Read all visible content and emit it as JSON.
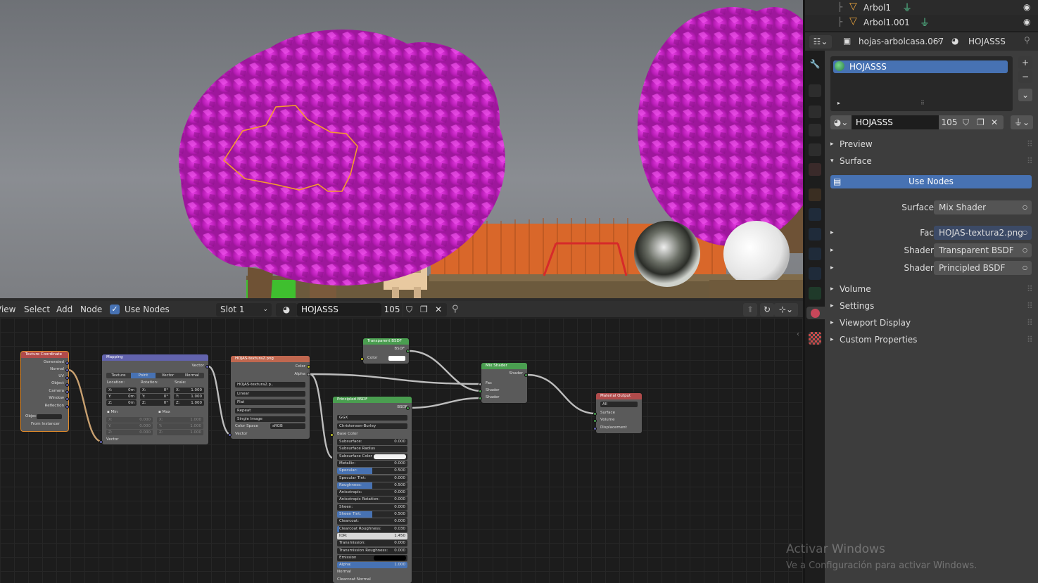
{
  "node_header": {
    "menu": [
      "View",
      "Select",
      "Add",
      "Node"
    ],
    "use_nodes_label": "Use Nodes",
    "slot": "Slot 1",
    "material_name": "HOJASSS",
    "users": "105"
  },
  "nodes": {
    "texcoord": {
      "title": "Texture Coordinate",
      "outputs": [
        "Generated",
        "Normal",
        "UV",
        "Object",
        "Camera",
        "Window",
        "Reflection"
      ],
      "object_label": "Objec",
      "from_instancer": "From Instancer"
    },
    "mapping": {
      "title": "Mapping",
      "output": "Vector",
      "types": [
        "Texture",
        "Point",
        "Vector",
        "Normal"
      ],
      "col_labels": [
        "Location:",
        "Rotation:",
        "Scale:"
      ],
      "loc": [
        "0m",
        "0m",
        "0m"
      ],
      "rot": [
        "0°",
        "0°",
        "0°"
      ],
      "scale": [
        "1.000",
        "1.000",
        "1.000"
      ],
      "min_label": "Min",
      "max_label": "Max",
      "min": [
        "0.000",
        "0.000",
        "0.000"
      ],
      "max": [
        "1.000",
        "1.000",
        "1.000"
      ],
      "input": "Vector"
    },
    "image": {
      "title": "HOJAS-textura2.png",
      "outputs": [
        "Color",
        "Alpha"
      ],
      "image_name": "HOJAS-textura2.p..",
      "interp": "Linear",
      "proj": "Flat",
      "ext": "Repeat",
      "source": "Single Image",
      "cs_label": "Color Space",
      "cs": "sRGB",
      "input": "Vector"
    },
    "transparent": {
      "title": "Transparent BSDF",
      "output": "BSDF",
      "color": "Color"
    },
    "principled": {
      "title": "Principled BSDF",
      "output": "BSDF",
      "dist": "GGX",
      "sss": "Christensen-Burley",
      "base": "Base Color",
      "props": [
        {
          "l": "Subsurface:",
          "v": "0.000",
          "f": 0
        },
        {
          "l": "Subsurface Radius",
          "v": "",
          "f": 0
        },
        {
          "l": "Subsurface Color",
          "v": "",
          "f": 0,
          "white": true
        },
        {
          "l": "Metallic:",
          "v": "0.000",
          "f": 0
        },
        {
          "l": "Specular:",
          "v": "0.500",
          "f": 0.5
        },
        {
          "l": "Specular Tint:",
          "v": "0.000",
          "f": 0
        },
        {
          "l": "Roughness:",
          "v": "0.500",
          "f": 0.5
        },
        {
          "l": "Anisotropic:",
          "v": "0.000",
          "f": 0
        },
        {
          "l": "Anisotropic Rotation:",
          "v": "0.000",
          "f": 0
        },
        {
          "l": "Sheen:",
          "v": "0.000",
          "f": 0
        },
        {
          "l": "Sheen Tint:",
          "v": "0.500",
          "f": 0.5
        },
        {
          "l": "Clearcoat:",
          "v": "0.000",
          "f": 0
        },
        {
          "l": "Clearcoat Roughness:",
          "v": "0.030",
          "f": 0.03
        },
        {
          "l": "IOR:",
          "v": "1.450",
          "f": 0,
          "light": true
        },
        {
          "l": "Transmission:",
          "v": "0.000",
          "f": 0
        },
        {
          "l": "Transmission Roughness:",
          "v": "0.000",
          "f": 0
        },
        {
          "l": "Emission",
          "v": "",
          "f": 0,
          "black": true
        },
        {
          "l": "Alpha:",
          "v": "1.000",
          "f": 1
        },
        {
          "l": "Normal",
          "v": "",
          "f": 0,
          "plain": true
        },
        {
          "l": "Clearcoat Normal",
          "v": "",
          "f": 0,
          "plain": true
        }
      ]
    },
    "mix": {
      "title": "Mix Shader",
      "output": "Shader",
      "inputs": [
        "Fac",
        "Shader",
        "Shader"
      ]
    },
    "output": {
      "title": "Material Output",
      "target": "All",
      "inputs": [
        "Surface",
        "Volume",
        "Displacement"
      ]
    }
  },
  "outliner": {
    "items": [
      "Arbol1",
      "Arbol1.001"
    ]
  },
  "properties": {
    "breadcrumb_object": "hojas-arbolcasa.067",
    "breadcrumb_material": "HOJASSS",
    "slot_item": "HOJASSS",
    "material_name": "HOJASSS",
    "users": "105",
    "panels": {
      "preview": "Preview",
      "surface": "Surface",
      "volume": "Volume",
      "settings": "Settings",
      "viewport_display": "Viewport Display",
      "custom": "Custom Properties"
    },
    "use_nodes": "Use Nodes",
    "surface_label": "Surface",
    "surface_value": "Mix Shader",
    "inputs": [
      {
        "label": "Fac",
        "value": "HOJAS-textura2.png"
      },
      {
        "label": "Shader",
        "value": "Transparent BSDF"
      },
      {
        "label": "Shader",
        "value": "Principled BSDF"
      }
    ]
  },
  "watermark": {
    "line1": "Activar Windows",
    "line2": "Ve a Configuración para activar Windows."
  },
  "colors": {
    "accent": "#4772b3",
    "node_texture": "#c0674f",
    "node_input": "#b04b4b",
    "node_vector": "#6263ad",
    "node_shader": "#4a9e50",
    "leaf": "#d21fd0",
    "fence": "#d9672a"
  }
}
